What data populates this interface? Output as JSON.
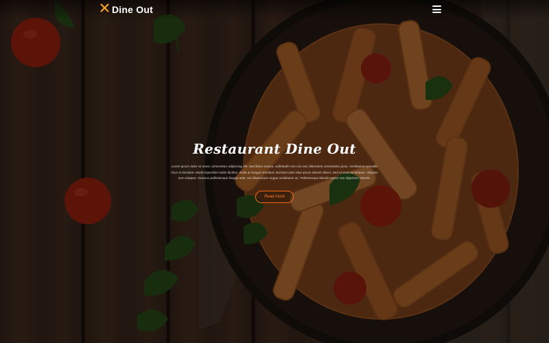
{
  "brand": {
    "name": "Dine Out",
    "logo_icon": "crossed-utensils-icon",
    "accent": "#f5a623"
  },
  "nav": {
    "menu_icon": "hamburger-menu-icon"
  },
  "hero": {
    "title": "Restaurant Dine Out",
    "description": "Lorem ipsum dolor sit amet, consectetur adipiscing elit. Sed libero massa, sollicitudin non nisi sed, bibendum consectetur justo. Vestibulum convallis risus at tincidunt. Morbi imperdiet mattis facilisis. Nulla at congue tincidunt, tincidunt ante vitae ipsum lobortis libero. Sed id amet mi tempus. Aliquam erat volutpat. Vivamus pellentesque feugiat ante, vel ullamcorper augue vestibulum ac. Pellentesque blandit sapien non dignissim lobortis.",
    "cta_label": "Read more",
    "cta_color": "#ff6a13"
  }
}
